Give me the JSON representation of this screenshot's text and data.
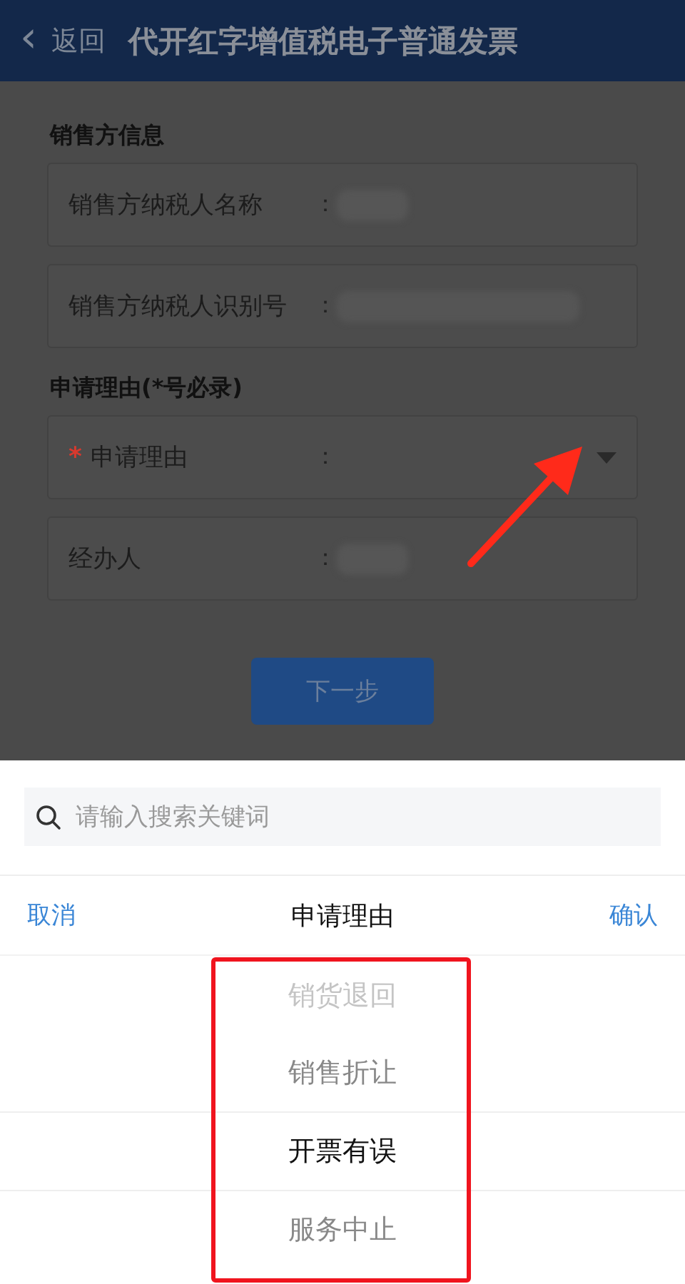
{
  "header": {
    "back_icon": "‹",
    "back_label": "返回",
    "title": "代开红字增值税电子普通发票"
  },
  "sections": [
    {
      "heading": "销售方信息",
      "fields": [
        {
          "kind": "text",
          "label": "销售方纳税人名称",
          "separator": "：",
          "required": false,
          "redacted": true
        },
        {
          "kind": "text",
          "label": "销售方纳税人识别号",
          "separator": "：",
          "required": false,
          "redacted": true
        }
      ]
    },
    {
      "heading": "申请理由(*号必录)",
      "fields": [
        {
          "kind": "select",
          "required_mark": "*",
          "label": "申请理由",
          "separator": "：",
          "required": true,
          "redacted": false
        },
        {
          "kind": "text",
          "label": "经办人",
          "separator": "：",
          "required": false,
          "redacted": true
        }
      ]
    }
  ],
  "next_button": "下一步",
  "sheet": {
    "search": {
      "placeholder": "请输入搜索关键词"
    },
    "cancel": "取消",
    "title": "申请理由",
    "confirm": "确认",
    "options": [
      {
        "label": "销货退回",
        "selected": false
      },
      {
        "label": "销售折让",
        "selected": false
      },
      {
        "label": "开票有误",
        "selected": true
      },
      {
        "label": "服务中止",
        "selected": false
      }
    ]
  }
}
